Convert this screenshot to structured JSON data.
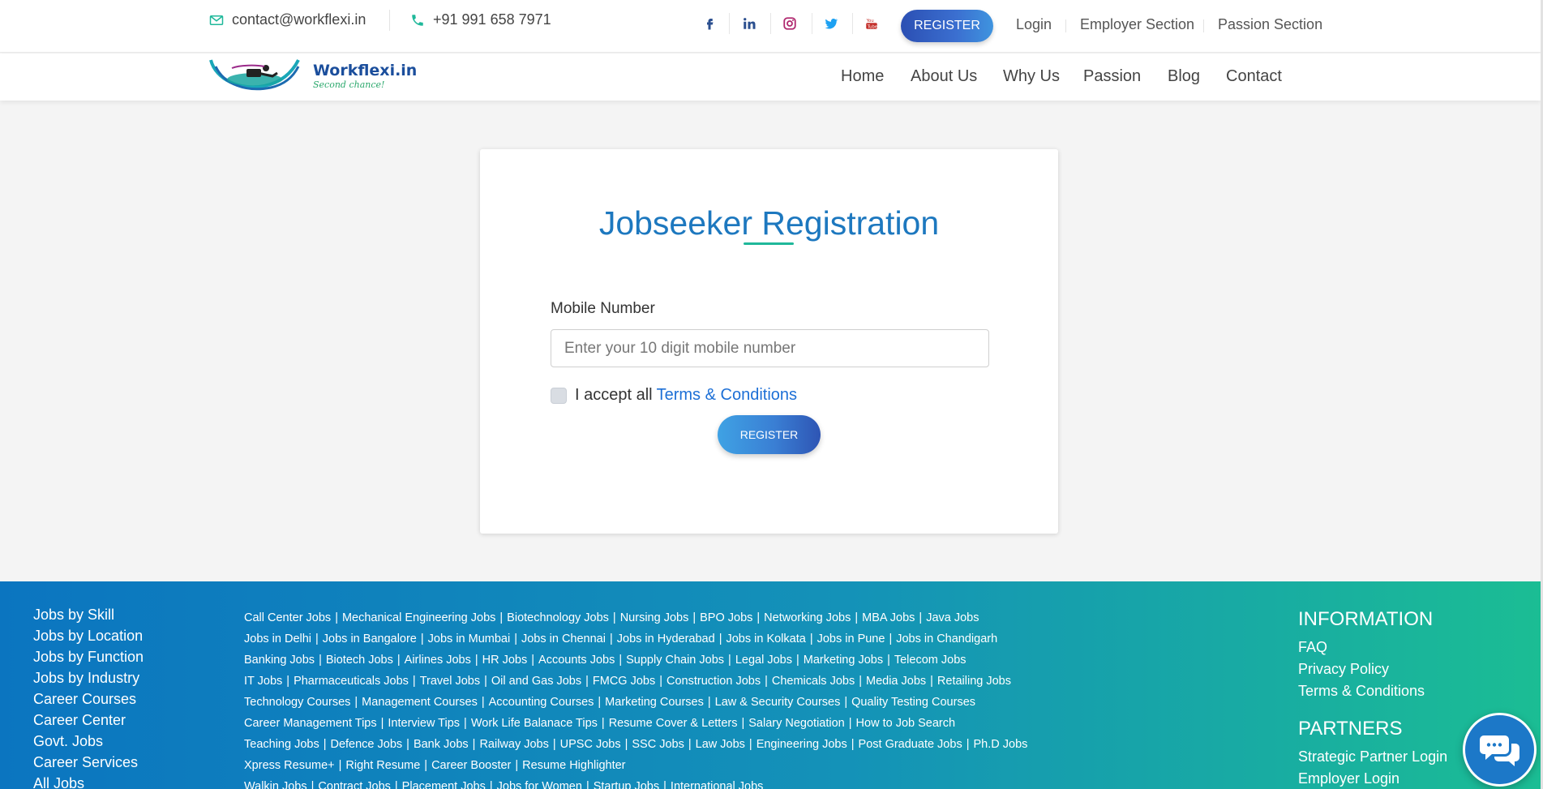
{
  "topbar": {
    "email": "contact@workflexi.in",
    "phone": "+91 991 658 7971",
    "social_icons": [
      "facebook-icon",
      "linkedin-icon",
      "instagram-icon",
      "twitter-icon",
      "youtube-icon"
    ],
    "register_label": "REGISTER",
    "links": [
      "Login",
      "Employer Section",
      "Passion Section"
    ]
  },
  "brand": {
    "name": "Workflexi.in",
    "tagline": "Second chance!"
  },
  "nav": [
    "Home",
    "About Us",
    "Why Us",
    "Passion",
    "Blog",
    "Contact"
  ],
  "form": {
    "title": "Jobseeker Registration",
    "mobile_label": "Mobile Number",
    "mobile_placeholder": "Enter your 10 digit mobile number",
    "mobile_value": "",
    "accept_text": "I accept all",
    "terms_link": "Terms & Conditions",
    "accepted": false,
    "submit_label": "REGISTER"
  },
  "footer": {
    "categories": [
      "Jobs by Skill",
      "Jobs by Location",
      "Jobs by Function",
      "Jobs by Industry",
      "Career Courses",
      "Career Center",
      "Govt. Jobs",
      "Career Services",
      "All Jobs"
    ],
    "link_rows": [
      [
        "Call Center Jobs",
        "Mechanical Engineering Jobs",
        "Biotechnology Jobs",
        "Nursing Jobs",
        "BPO Jobs",
        "Networking Jobs",
        "MBA Jobs",
        "Java Jobs"
      ],
      [
        "Jobs in Delhi",
        "Jobs in Bangalore",
        "Jobs in Mumbai",
        "Jobs in Chennai",
        "Jobs in Hyderabad",
        "Jobs in Kolkata",
        "Jobs in Pune",
        "Jobs in Chandigarh"
      ],
      [
        "Banking Jobs",
        "Biotech Jobs",
        "Airlines Jobs",
        "HR Jobs",
        "Accounts Jobs",
        "Supply Chain Jobs",
        "Legal Jobs",
        "Marketing Jobs",
        "Telecom Jobs"
      ],
      [
        "IT Jobs",
        "Pharmaceuticals Jobs",
        "Travel Jobs",
        "Oil and Gas Jobs",
        "FMCG Jobs",
        "Construction Jobs",
        "Chemicals Jobs",
        "Media Jobs",
        "Retailing Jobs"
      ],
      [
        "Technology Courses",
        "Management Courses",
        "Accounting Courses",
        "Marketing Courses",
        "Law & Security Courses",
        "Quality Testing Courses"
      ],
      [
        "Career Management Tips",
        "Interview Tips",
        "Work Life Balanace Tips",
        "Resume Cover & Letters",
        "Salary Negotiation",
        "How to Job Search"
      ],
      [
        "Teaching Jobs",
        "Defence Jobs",
        "Bank Jobs",
        "Railway Jobs",
        "UPSC Jobs",
        "SSC Jobs",
        "Law Jobs",
        "Engineering Jobs",
        "Post Graduate Jobs",
        "Ph.D Jobs"
      ],
      [
        "Xpress Resume+",
        "Right Resume",
        "Career Booster",
        "Resume Highlighter"
      ],
      [
        "Walkin Jobs",
        "Contract Jobs",
        "Placement Jobs",
        "Jobs for Women",
        "Startup Jobs",
        "International Jobs"
      ]
    ],
    "info_heading": "INFORMATION",
    "info_links": [
      "FAQ",
      "Privacy Policy",
      "Terms & Conditions"
    ],
    "partners_heading": "PARTNERS",
    "partner_links": [
      "Strategic Partner Login",
      "Employer Login"
    ]
  },
  "colors": {
    "accent_blue": "#1d78bf",
    "accent_teal": "#1fb89a",
    "footer_start": "#0b75c0",
    "footer_end": "#1bbd94"
  }
}
